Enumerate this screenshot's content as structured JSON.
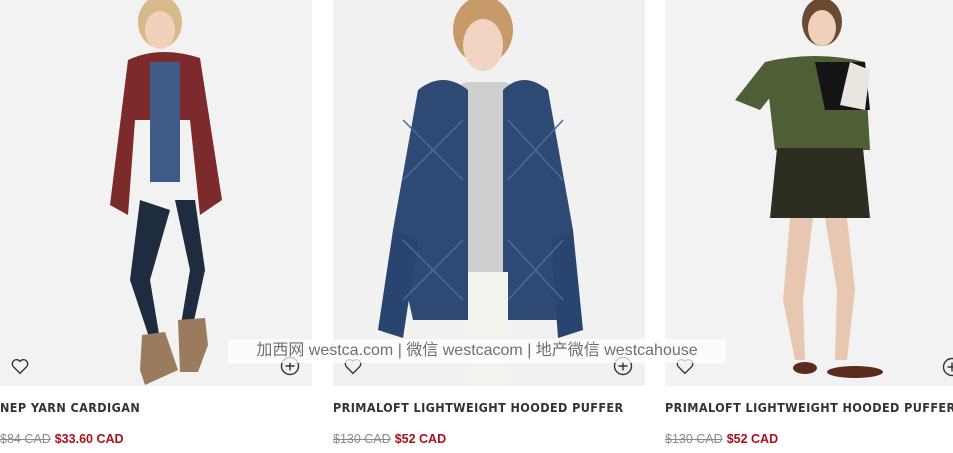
{
  "products": [
    {
      "name": "NEP YARN CARDIGAN",
      "original_price": "$84 CAD",
      "sale_price": "$33.60 CAD"
    },
    {
      "name": "PRIMALOFT LIGHTWEIGHT HOODED PUFFER",
      "original_price": "$130 CAD",
      "sale_price": "$52 CAD"
    },
    {
      "name": "PRIMALOFT LIGHTWEIGHT HOODED PUFFER",
      "original_price": "$130 CAD",
      "sale_price": "$52 CAD"
    }
  ],
  "watermark": "加西网 westca.com | 微信 westcacom | 地产微信 westcahouse",
  "icons": {
    "wishlist": "heart-outline-icon",
    "quick_add": "circle-plus-icon"
  },
  "colors": {
    "sale": "#b00d1a",
    "original": "#8a8a8a",
    "name": "#333333"
  }
}
